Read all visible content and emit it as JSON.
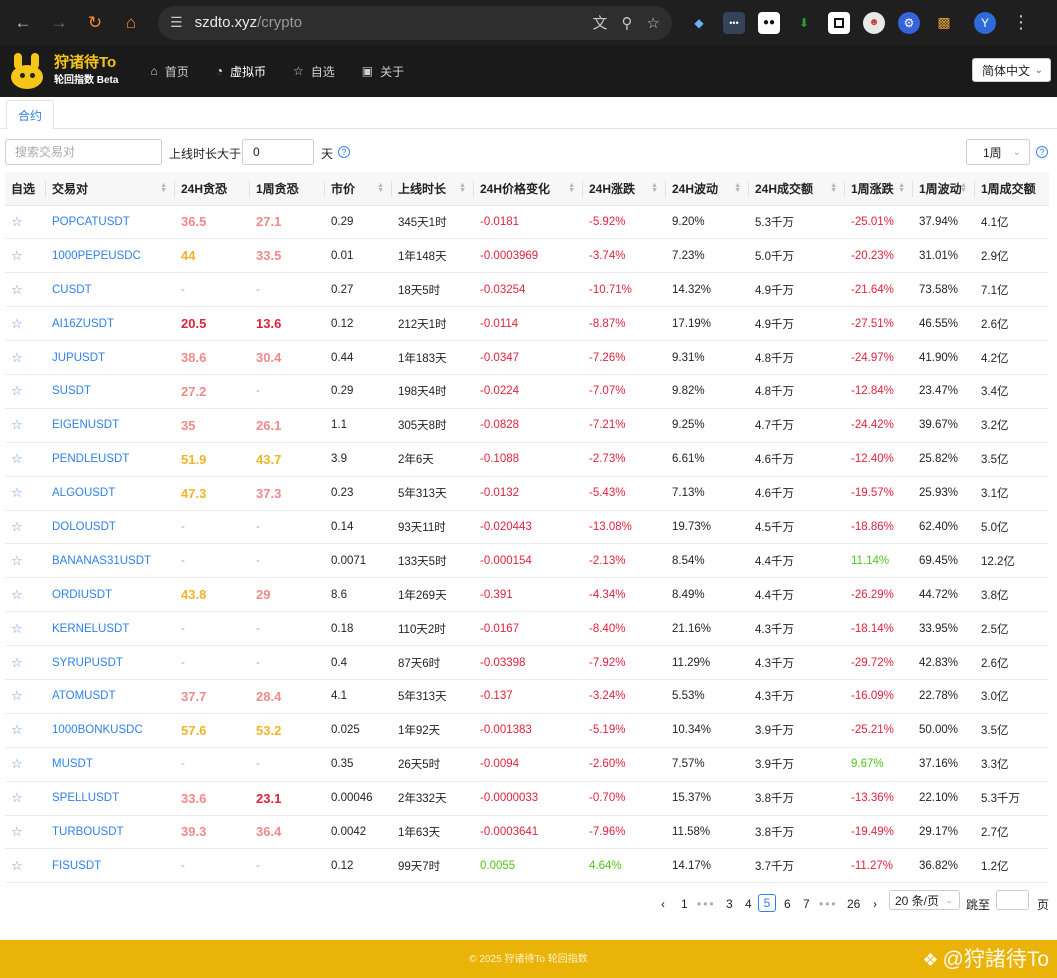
{
  "browser": {
    "url_host": "szdto.xyz",
    "url_path": "/crypto",
    "avatar_letter": "Y"
  },
  "site": {
    "brand_title": "狩诸待To",
    "brand_subtitle": "轮回指数 Beta",
    "menu": [
      {
        "label": "首页",
        "icon": "home-icon"
      },
      {
        "label": "虚拟币",
        "icon": "coin-icon"
      },
      {
        "label": "自选",
        "icon": "star-icon"
      },
      {
        "label": "关于",
        "icon": "calendar-icon"
      }
    ],
    "language": "简体中文"
  },
  "tabs": {
    "active": "合约"
  },
  "filters": {
    "search_placeholder": "搜索交易对",
    "online_label": "上线时长大于",
    "days_value": "0",
    "days_unit": "天",
    "period": "1周"
  },
  "table": {
    "headers": [
      "自选",
      "交易对",
      "24H贪恐",
      "1周贪恐",
      "市价",
      "上线时长",
      "24H价格变化",
      "24H涨跌",
      "24H波动",
      "24H成交额",
      "1周涨跌",
      "1周波动",
      "1周成交额"
    ],
    "rows": [
      {
        "pair": "POPCATUSDT",
        "fear24": "36.5",
        "fear1w": "27.1",
        "price": "0.29",
        "age": "345天1时",
        "chg": "-0.0181",
        "pct24": "-5.92%",
        "vol24": "9.20%",
        "amt24": "5.3千万",
        "pct1w": "-25.01%",
        "vol1w": "37.94%",
        "amt1w": "4.1亿"
      },
      {
        "pair": "1000PEPEUSDC",
        "fear24": "44",
        "fear1w": "33.5",
        "price": "0.01",
        "age": "1年148天",
        "chg": "-0.0003969",
        "pct24": "-3.74%",
        "vol24": "7.23%",
        "amt24": "5.0千万",
        "pct1w": "-20.23%",
        "vol1w": "31.01%",
        "amt1w": "2.9亿"
      },
      {
        "pair": "CUSDT",
        "fear24": "-",
        "fear1w": "-",
        "price": "0.27",
        "age": "18天5时",
        "chg": "-0.03254",
        "pct24": "-10.71%",
        "vol24": "14.32%",
        "amt24": "4.9千万",
        "pct1w": "-21.64%",
        "vol1w": "73.58%",
        "amt1w": "7.1亿"
      },
      {
        "pair": "AI16ZUSDT",
        "fear24": "20.5",
        "fear1w": "13.6",
        "price": "0.12",
        "age": "212天1时",
        "chg": "-0.0114",
        "pct24": "-8.87%",
        "vol24": "17.19%",
        "amt24": "4.9千万",
        "pct1w": "-27.51%",
        "vol1w": "46.55%",
        "amt1w": "2.6亿"
      },
      {
        "pair": "JUPUSDT",
        "fear24": "38.6",
        "fear1w": "30.4",
        "price": "0.44",
        "age": "1年183天",
        "chg": "-0.0347",
        "pct24": "-7.26%",
        "vol24": "9.31%",
        "amt24": "4.8千万",
        "pct1w": "-24.97%",
        "vol1w": "41.90%",
        "amt1w": "4.2亿"
      },
      {
        "pair": "SUSDT",
        "fear24": "27.2",
        "fear1w": "-",
        "price": "0.29",
        "age": "198天4时",
        "chg": "-0.0224",
        "pct24": "-7.07%",
        "vol24": "9.82%",
        "amt24": "4.8千万",
        "pct1w": "-12.84%",
        "vol1w": "23.47%",
        "amt1w": "3.4亿"
      },
      {
        "pair": "EIGENUSDT",
        "fear24": "35",
        "fear1w": "26.1",
        "price": "1.1",
        "age": "305天8时",
        "chg": "-0.0828",
        "pct24": "-7.21%",
        "vol24": "9.25%",
        "amt24": "4.7千万",
        "pct1w": "-24.42%",
        "vol1w": "39.67%",
        "amt1w": "3.2亿"
      },
      {
        "pair": "PENDLEUSDT",
        "fear24": "51.9",
        "fear1w": "43.7",
        "price": "3.9",
        "age": "2年6天",
        "chg": "-0.1088",
        "pct24": "-2.73%",
        "vol24": "6.61%",
        "amt24": "4.6千万",
        "pct1w": "-12.40%",
        "vol1w": "25.82%",
        "amt1w": "3.5亿"
      },
      {
        "pair": "ALGOUSDT",
        "fear24": "47.3",
        "fear1w": "37.3",
        "price": "0.23",
        "age": "5年313天",
        "chg": "-0.0132",
        "pct24": "-5.43%",
        "vol24": "7.13%",
        "amt24": "4.6千万",
        "pct1w": "-19.57%",
        "vol1w": "25.93%",
        "amt1w": "3.1亿"
      },
      {
        "pair": "DOLOUSDT",
        "fear24": "-",
        "fear1w": "-",
        "price": "0.14",
        "age": "93天11时",
        "chg": "-0.020443",
        "pct24": "-13.08%",
        "vol24": "19.73%",
        "amt24": "4.5千万",
        "pct1w": "-18.86%",
        "vol1w": "62.40%",
        "amt1w": "5.0亿"
      },
      {
        "pair": "BANANAS31USDT",
        "fear24": "-",
        "fear1w": "-",
        "price": "0.0071",
        "age": "133天5时",
        "chg": "-0.000154",
        "pct24": "-2.13%",
        "vol24": "8.54%",
        "amt24": "4.4千万",
        "pct1w": "11.14%",
        "vol1w": "69.45%",
        "amt1w": "12.2亿"
      },
      {
        "pair": "ORDIUSDT",
        "fear24": "43.8",
        "fear1w": "29",
        "price": "8.6",
        "age": "1年269天",
        "chg": "-0.391",
        "pct24": "-4.34%",
        "vol24": "8.49%",
        "amt24": "4.4千万",
        "pct1w": "-26.29%",
        "vol1w": "44.72%",
        "amt1w": "3.8亿"
      },
      {
        "pair": "KERNELUSDT",
        "fear24": "-",
        "fear1w": "-",
        "price": "0.18",
        "age": "110天2时",
        "chg": "-0.0167",
        "pct24": "-8.40%",
        "vol24": "21.16%",
        "amt24": "4.3千万",
        "pct1w": "-18.14%",
        "vol1w": "33.95%",
        "amt1w": "2.5亿"
      },
      {
        "pair": "SYRUPUSDT",
        "fear24": "-",
        "fear1w": "-",
        "price": "0.4",
        "age": "87天6时",
        "chg": "-0.03398",
        "pct24": "-7.92%",
        "vol24": "11.29%",
        "amt24": "4.3千万",
        "pct1w": "-29.72%",
        "vol1w": "42.83%",
        "amt1w": "2.6亿"
      },
      {
        "pair": "ATOMUSDT",
        "fear24": "37.7",
        "fear1w": "28.4",
        "price": "4.1",
        "age": "5年313天",
        "chg": "-0.137",
        "pct24": "-3.24%",
        "vol24": "5.53%",
        "amt24": "4.3千万",
        "pct1w": "-16.09%",
        "vol1w": "22.78%",
        "amt1w": "3.0亿"
      },
      {
        "pair": "1000BONKUSDC",
        "fear24": "57.6",
        "fear1w": "53.2",
        "price": "0.025",
        "age": "1年92天",
        "chg": "-0.001383",
        "pct24": "-5.19%",
        "vol24": "10.34%",
        "amt24": "3.9千万",
        "pct1w": "-25.21%",
        "vol1w": "50.00%",
        "amt1w": "3.5亿"
      },
      {
        "pair": "MUSDT",
        "fear24": "-",
        "fear1w": "-",
        "price": "0.35",
        "age": "26天5时",
        "chg": "-0.0094",
        "pct24": "-2.60%",
        "vol24": "7.57%",
        "amt24": "3.9千万",
        "pct1w": "9.67%",
        "vol1w": "37.16%",
        "amt1w": "3.3亿"
      },
      {
        "pair": "SPELLUSDT",
        "fear24": "33.6",
        "fear1w": "23.1",
        "price": "0.00046",
        "age": "2年332天",
        "chg": "-0.0000033",
        "pct24": "-0.70%",
        "vol24": "15.37%",
        "amt24": "3.8千万",
        "pct1w": "-13.36%",
        "vol1w": "22.10%",
        "amt1w": "5.3千万"
      },
      {
        "pair": "TURBOUSDT",
        "fear24": "39.3",
        "fear1w": "36.4",
        "price": "0.0042",
        "age": "1年63天",
        "chg": "-0.0003641",
        "pct24": "-7.96%",
        "vol24": "11.58%",
        "amt24": "3.8千万",
        "pct1w": "-19.49%",
        "vol1w": "29.17%",
        "amt1w": "2.7亿"
      },
      {
        "pair": "FISUSDT",
        "fear24": "-",
        "fear1w": "-",
        "price": "0.12",
        "age": "99天7时",
        "chg": "0.0055",
        "pct24": "4.64%",
        "vol24": "14.17%",
        "amt24": "3.7千万",
        "pct1w": "-11.27%",
        "vol1w": "36.82%",
        "amt1w": "1.2亿"
      }
    ]
  },
  "pagination": {
    "pages": [
      "1",
      "3",
      "4",
      "5",
      "6",
      "7",
      "26"
    ],
    "current": "5",
    "dots": "•••",
    "page_size": "20 条/页",
    "jump_label": "跳至",
    "page_unit": "页"
  },
  "footer": {
    "copyright": "© 2025 狩诸待To 轮回指数",
    "watermark": "@狩諸待To"
  },
  "colors": {
    "accent": "#2f80ed",
    "negative": "#e0223c",
    "positive": "#52c41a",
    "fear_strong": "#e0223c",
    "fear_mid": "#f08a8a",
    "fear_neutral": "#f0b429",
    "footer_bg": "#eab308",
    "brand": "#f5c518"
  }
}
